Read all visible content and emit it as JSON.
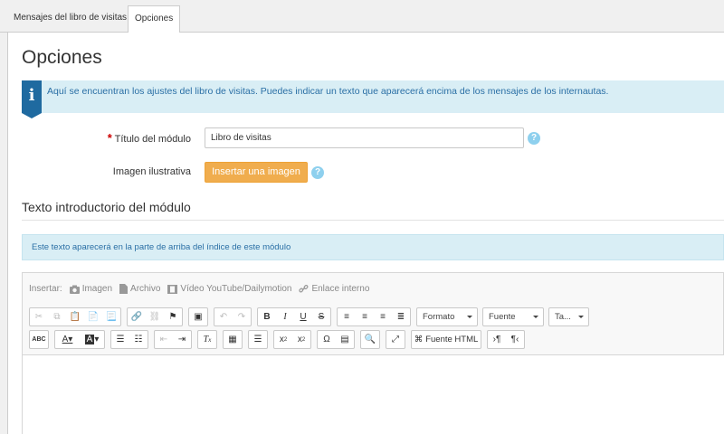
{
  "tabs": [
    {
      "label": "Mensajes del libro de visitas"
    },
    {
      "label": "Opciones"
    }
  ],
  "page_title": "Opciones",
  "info_message": "Aquí se encuentran los ajustes del libro de visitas. Puedes indicar un texto que aparecerá encima de los mensajes de los internautas.",
  "form": {
    "title_label": "Título del módulo",
    "title_value": "Libro de visitas",
    "image_label": "Imagen ilustrativa",
    "insert_image_button": "Insertar una imagen",
    "help_glyph": "?"
  },
  "section": {
    "title": "Texto introductorio del módulo",
    "info": "Este texto aparecerá en la parte de arriba del índice de este módulo"
  },
  "editor": {
    "insert_label": "Insertar:",
    "insert_items": [
      "Imagen",
      "Archivo",
      "Vídeo YouTube/Dailymotion",
      "Enlace interno"
    ],
    "dropdowns": [
      "Formato",
      "Fuente",
      "Ta..."
    ],
    "source_button": "Fuente HTML"
  },
  "colors": {
    "accent": "#1f6aa0",
    "info_bg": "#d9eef5",
    "button_orange": "#f0ad4e",
    "help_icon": "#8ed0ee"
  }
}
